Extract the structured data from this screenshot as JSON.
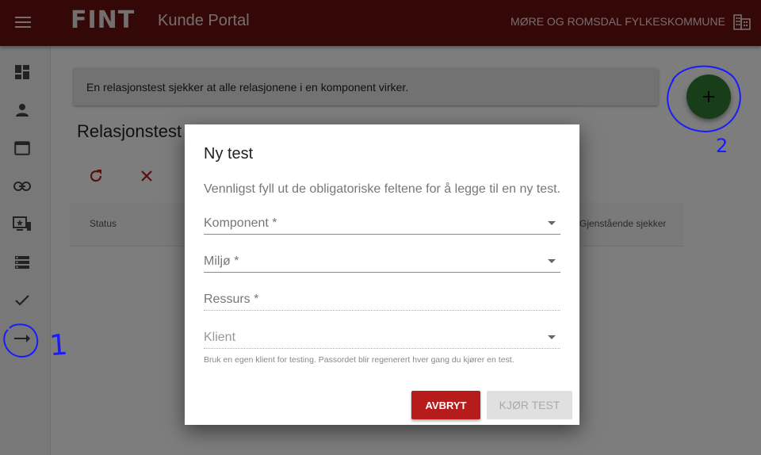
{
  "header": {
    "logo": "FINT",
    "title": "Kunde Portal",
    "organization": "MØRE OG ROMSDAL FYLKESKOMMUNE",
    "menu_icon": "menu-icon",
    "org_icon": "domain-icon"
  },
  "sidebar": {
    "items": [
      {
        "icon": "dashboard-icon"
      },
      {
        "icon": "person-icon"
      },
      {
        "icon": "web-asset-icon"
      },
      {
        "icon": "link-icon"
      },
      {
        "icon": "important-devices-icon"
      },
      {
        "icon": "storage-icon"
      },
      {
        "icon": "check-icon"
      },
      {
        "icon": "arrow-right-icon"
      }
    ]
  },
  "main": {
    "info": "En relasjonstest sjekker at alle relasjonene i en komponent virker.",
    "title": "Relasjonstest",
    "table_headers": {
      "status": "Status",
      "remaining": "Gjenstående sjekker"
    },
    "fab_icon": "add-icon"
  },
  "annotations": {
    "label_1": "1",
    "label_2": "2"
  },
  "dialog": {
    "title": "Ny test",
    "description": "Vennligst fyll ut de obligatoriske feltene for å legge til en ny test.",
    "fields": [
      {
        "label": "Komponent *",
        "type": "select"
      },
      {
        "label": "Miljø *",
        "type": "select"
      },
      {
        "label": "Ressurs *",
        "type": "text"
      },
      {
        "label": "Klient",
        "type": "select"
      }
    ],
    "helper": "Bruk en egen klient for testing. Passordet blir regenerert hver gang du kjører en test.",
    "cancel_label": "AVBRYT",
    "run_label": "KJØR TEST"
  },
  "colors": {
    "topbar": "#6b1010",
    "accent": "#b71c1c",
    "fab": "#2e7d32",
    "annotation": "#1a1aff"
  }
}
